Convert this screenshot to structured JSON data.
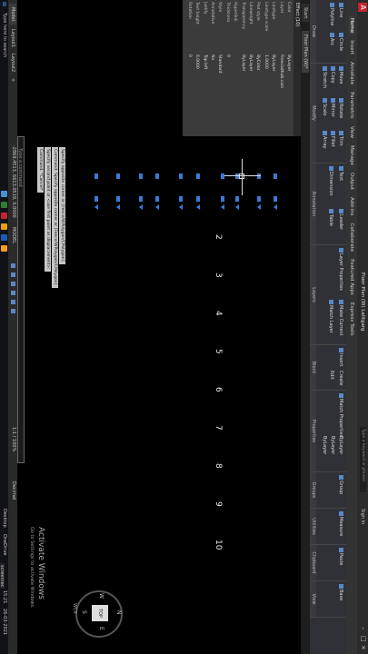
{
  "app": {
    "title": "Floor Plan (W) Lalitgarg",
    "search_placeholder": "Type a keyword or phrase",
    "sign_in": "Sign In"
  },
  "ribbon_tabs": [
    "Home",
    "Insert",
    "Annotate",
    "Parametric",
    "View",
    "Manage",
    "Output",
    "Add-ins",
    "Collaborate",
    "Featured Apps",
    "Express Tools"
  ],
  "ribbon_panels": {
    "draw": {
      "name": "Draw",
      "tools": [
        "Line",
        "Polyline",
        "Circle",
        "Arc"
      ]
    },
    "modify": {
      "name": "Modify",
      "tools": [
        "Move",
        "Rotate",
        "Trim",
        "Copy",
        "Mirror",
        "Fillet",
        "Stretch",
        "Scale",
        "Array"
      ]
    },
    "annotation": {
      "name": "Annotation",
      "tools": [
        "Text",
        "Dimension",
        "Leader",
        "Table"
      ]
    },
    "layers": {
      "name": "Layers",
      "tools": [
        "Layer Properties",
        "Make Current",
        "Match Layer"
      ]
    },
    "block": {
      "name": "Block",
      "tools": [
        "Insert",
        "Create",
        "Edit"
      ]
    },
    "properties": {
      "name": "Properties",
      "tools": [
        "Match Properties",
        "ByLayer",
        "ByLayer",
        "ByLayer"
      ]
    },
    "groups": {
      "name": "Groups",
      "tools": [
        "Group"
      ]
    },
    "utilities": {
      "name": "Utilities",
      "tools": [
        "Measure"
      ]
    },
    "clipboard": {
      "name": "Clipboard",
      "tools": [
        "Paste"
      ]
    },
    "view": {
      "name": "View",
      "tools": [
        "Base"
      ]
    }
  },
  "file_tabs": [
    "Start",
    "Floor Plan (W)*"
  ],
  "properties_palette": {
    "header": "Effect (10)",
    "rows": [
      {
        "label": "Color",
        "value": "ByLayer"
      },
      {
        "label": "Layer",
        "value": "Freecadhub.com"
      },
      {
        "label": "Linetype",
        "value": "ByLayer"
      },
      {
        "label": "Linetype scale",
        "value": "1.0000"
      },
      {
        "label": "Plot style",
        "value": "ByColor"
      },
      {
        "label": "Lineweight",
        "value": "ByLayer"
      },
      {
        "label": "Transparency",
        "value": "ByLayer"
      },
      {
        "label": "Hyperlink",
        "value": ""
      },
      {
        "label": "Thickness",
        "value": "0"
      },
      {
        "label": "Style",
        "value": "Standard"
      },
      {
        "label": "Annotative",
        "value": "No"
      },
      {
        "label": "Justify",
        "value": "Top left"
      },
      {
        "label": "Text height",
        "value": "6.0000"
      },
      {
        "label": "Rotation",
        "value": "0"
      }
    ]
  },
  "canvas_labels": [
    "2",
    "3",
    "4",
    "5",
    "6",
    "7",
    "8",
    "9",
    "10"
  ],
  "command_history": [
    "Specify opposite corner or [Fence/WPolygon/CPolygon]:",
    "Command: Specify opposite corner or [Fence/WPolygon/CPolygon]:",
    "Specify second point or <use first point as displacement>:",
    "Command: *Cancel*"
  ],
  "command_placeholder": "Type a command",
  "layout_tabs": [
    "Model",
    "Layout1",
    "Layout2"
  ],
  "status": {
    "coords": "-2869.4513, 6613.0519, 0.0000",
    "model": "MODEL",
    "scale": "1:1 / 100%",
    "units": "Decimal"
  },
  "activate": {
    "title": "Activate Windows",
    "subtitle": "Go to Settings to activate Windows."
  },
  "viewcube": {
    "face": "TOP",
    "north": "N",
    "west": "W",
    "east": "E",
    "south": "S",
    "wcs": "WCS"
  },
  "taskbar": {
    "search": "Type here to search",
    "time": "15:21",
    "date": "26-03-2021",
    "desktop": "Desktop",
    "onedrive": "OneDrive",
    "screen": "screenrec"
  },
  "colors": {
    "accent": "#3a7bd5",
    "bg": "#000000",
    "ribbon": "#2f3136"
  }
}
